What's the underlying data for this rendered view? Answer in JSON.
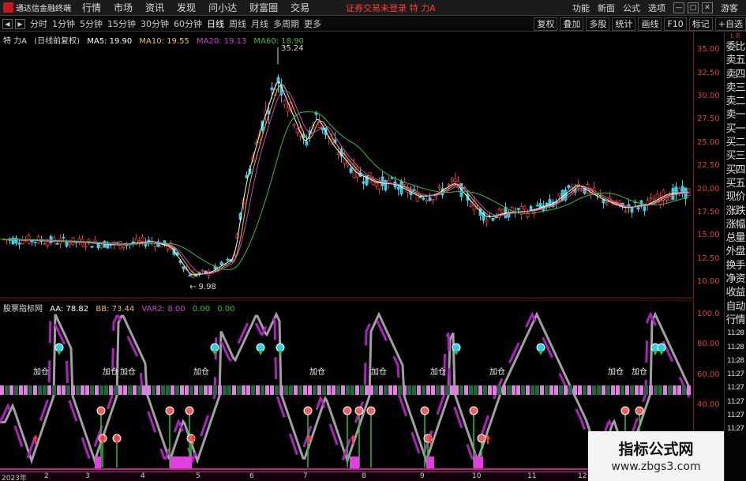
{
  "menubar": {
    "app_title": "通达信金融终端",
    "menus": [
      "行情",
      "市场",
      "资讯",
      "发现",
      "问小达",
      "财富圈",
      "交易"
    ],
    "warning": "证券交易未登录 特 力A",
    "right_items": [
      "功能",
      "新面",
      "公式",
      "选项"
    ],
    "guest": "游客"
  },
  "toolbar": {
    "periods": [
      "分时",
      "1分钟",
      "5分钟",
      "15分钟",
      "30分钟",
      "60分钟",
      "日线",
      "周线",
      "月线",
      "多周期",
      "更多"
    ],
    "active_period": "日线",
    "right_buttons": [
      "复权",
      "叠加",
      "多股",
      "统计",
      "画线",
      "F10",
      "标记",
      "+自选"
    ]
  },
  "main_info": {
    "stock": "特 力A",
    "adj": "(日线前复权)",
    "ma5": "MA5: 19.90",
    "ma10": "MA10: 19.55",
    "ma20": "MA20: 19.13",
    "ma60": "MA60: 18.90",
    "high_label": "35.24",
    "low_label": "9.98",
    "colors": {
      "ma5": "#ffffff",
      "ma10": "#e8c23a",
      "ma20": "#d040d0",
      "ma60": "#2ec22e"
    }
  },
  "main_axis": [
    "35.00",
    "32.50",
    "30.00",
    "27.50",
    "25.00",
    "22.50",
    "20.00",
    "17.50",
    "15.00",
    "12.50",
    "10.00"
  ],
  "sub_info": {
    "name": "股票指标网",
    "aa": "AA: 78.82",
    "bb": "BB: 73.44",
    "var2": "VAR2: 8.00",
    "z1": "0.00",
    "z2": "0.00"
  },
  "sub_axis": [
    "100.0",
    "80.00",
    "60.00",
    "40.00"
  ],
  "signal_label": "加仓",
  "right_side": [
    "委比",
    "卖五",
    "卖四",
    "卖三",
    "卖二",
    "卖一",
    "买一",
    "买二",
    "买三",
    "买四",
    "买五",
    "现价",
    "涨跌",
    "涨幅",
    "总量",
    "外盘",
    "换手",
    "净资",
    "收益",
    "自动",
    "行情",
    "11:28",
    "11:28",
    "11:28",
    "11:27",
    "11:27",
    "11:27",
    "11:27",
    "11:27"
  ],
  "right_lr": [
    "L",
    "R"
  ],
  "bottom_axis": [
    "2023年",
    "2",
    "3",
    "4",
    "5",
    "6",
    "7",
    "8",
    "9",
    "10",
    "11",
    "12"
  ],
  "watermark": {
    "title": "指标公式网",
    "url": "www.zbgs3.com"
  }
}
